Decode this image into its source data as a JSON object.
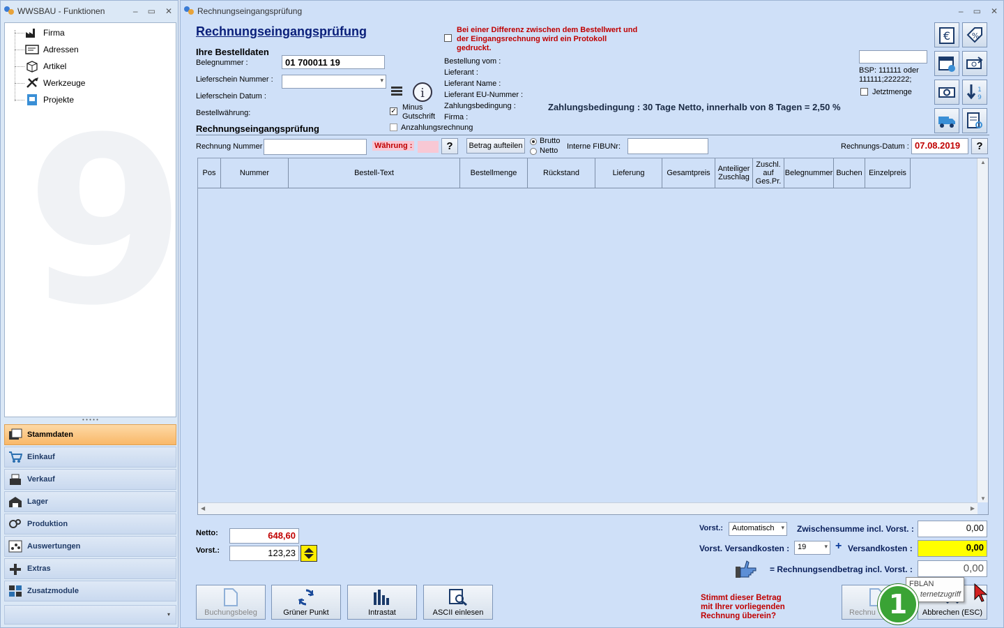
{
  "left_window": {
    "title": "WWSBAU - Funktionen",
    "tree": [
      {
        "label": "Firma",
        "icon": "factory-icon"
      },
      {
        "label": "Adressen",
        "icon": "address-card-icon"
      },
      {
        "label": "Artikel",
        "icon": "box-icon"
      },
      {
        "label": "Werkzeuge",
        "icon": "tools-icon"
      },
      {
        "label": "Projekte",
        "icon": "project-icon"
      }
    ],
    "nav": [
      {
        "label": "Stammdaten",
        "icon": "master-data-icon",
        "active": true
      },
      {
        "label": "Einkauf",
        "icon": "cart-icon"
      },
      {
        "label": "Verkauf",
        "icon": "cash-register-icon"
      },
      {
        "label": "Lager",
        "icon": "warehouse-icon"
      },
      {
        "label": "Produktion",
        "icon": "production-icon"
      },
      {
        "label": "Auswertungen",
        "icon": "analysis-icon"
      },
      {
        "label": "Extras",
        "icon": "extras-icon"
      },
      {
        "label": "Zusatzmodule",
        "icon": "modules-icon"
      }
    ]
  },
  "main_window": {
    "title": "Rechnungseingangsprüfung",
    "heading": "Rechnungseingangsprüfung",
    "order_section": "Ihre Bestelldaten",
    "belegnummer_label": "Belegnummer :",
    "belegnummer_value": "01 700011 19",
    "lieferschein_nummer_label": "Lieferschein Nummer :",
    "lieferschein_datum_label": "Lieferschein Datum :",
    "bestellwaehrung_label": "Bestellwährung:",
    "check_section": "Rechnungseingangsprüfung",
    "minus_gutschrift": "Minus Gutschrift",
    "anzahlungsrechnung": "Anzahlungsrechnung",
    "protokoll_warning": "Bei einer Differenz zwischen dem Bestellwert und der Eingangsrechnung wird ein Protokoll gedruckt.",
    "info_fields": [
      "Bestellung vom :",
      "Lieferant :",
      "Lieferant Name :",
      "Lieferant EU-Nummer :",
      "Zahlungsbedingung :",
      "Firma :"
    ],
    "zahlungsbedingung_text": "Zahlungsbedingung : 30 Tage Netto, innerhalb von 8 Tagen = 2,50 %",
    "bsp_hint": "BSP: 111111 oder 111111;222222;",
    "jetztmenge": "Jetztmenge",
    "rechnung_nummer_label": "Rechnung Nummer",
    "waehrung_label": "Währung :",
    "help_glyph": "?",
    "betrag_aufteilen": "Betrag aufteilen",
    "brutto": "Brutto",
    "netto": "Netto",
    "interne_fibu_label": "Interne FIBUNr:",
    "rechnungs_datum_label": "Rechnungs-Datum :",
    "rechnungs_datum_value": "07.08.2019",
    "columns": [
      "Pos",
      "Nummer",
      "Bestell-Text",
      "Bestellmenge",
      "Rückstand",
      "Lieferung",
      "Gesamtpreis",
      "Anteiliger Zuschlag",
      "Zuschl. auf Ges.Pr.",
      "Belegnummer",
      "Buchen",
      "Einzelpreis"
    ],
    "netto_label": "Netto:",
    "netto_value": "648,60",
    "vorst_label": "Vorst.:",
    "vorst_value": "123,23",
    "vorst_select_label": "Vorst.:",
    "vorst_select_value": "Automatisch",
    "zwischensumme_label": "Zwischensumme incl. Vorst. :",
    "zwischensumme_value": "0,00",
    "vorst_versand_label": "Vorst. Versandkosten :",
    "vorst_versand_value": "19",
    "plus_glyph": "+",
    "versandkosten_label": "Versandkosten :",
    "versandkosten_value": "0,00",
    "endbetrag_label": "= Rechnungsendbetrag incl. Vorst. :",
    "endbetrag_value": "0,00",
    "question_text": "Stimmt dieser Betrag mit Ihrer vorliegenden Rechnung überein?",
    "buttons": {
      "buchungsbeleg": "Buchungsbeleg",
      "gruener_punkt": "Grüner Punkt",
      "intrastat": "Intrastat",
      "ascii_einlesen": "ASCII einlesen",
      "rechnung": "Rechnu",
      "abbrechen": "Abbrechen (ESC)"
    },
    "tooltip_line1": "FBLAN",
    "tooltip_line2": "ternetzugriff",
    "badge_number": "1"
  },
  "colors": {
    "accent_title": "#0a1f7a",
    "warning_red": "#c00000",
    "highlight_yellow": "#ffff00",
    "badge_green": "#3aa335",
    "active_nav": "#f9b868"
  }
}
